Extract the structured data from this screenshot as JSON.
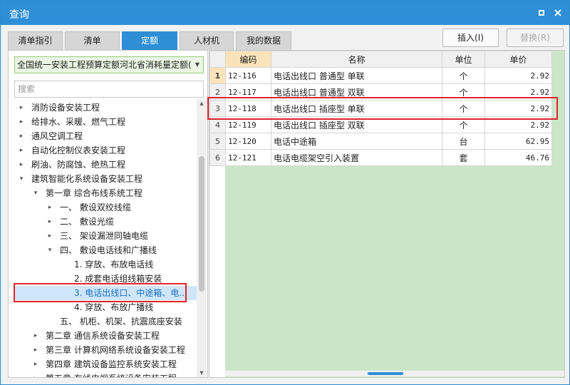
{
  "window": {
    "title": "查询",
    "maximize_icon": "maximize-icon",
    "close_icon": "close-icon",
    "close_glyph": "×"
  },
  "tabs": [
    {
      "label": "清单指引",
      "active": false
    },
    {
      "label": "清单",
      "active": false
    },
    {
      "label": "定额",
      "active": true
    },
    {
      "label": "人材机",
      "active": false
    },
    {
      "label": "我的数据",
      "active": false
    }
  ],
  "actions": {
    "insert_label": "插入(I)",
    "replace_label": "替换(R)",
    "replace_disabled": true
  },
  "left": {
    "quota_db": "全国统一安装工程预算定额河北省消耗量定额(",
    "search_placeholder": "搜索",
    "tree": [
      {
        "label": "消防设备安装工程",
        "level": 0,
        "toggle": "▸"
      },
      {
        "label": "给排水、采暖、燃气工程",
        "level": 0,
        "toggle": "▸"
      },
      {
        "label": "通风空调工程",
        "level": 0,
        "toggle": "▸"
      },
      {
        "label": "自动化控制仪表安装工程",
        "level": 0,
        "toggle": "▸"
      },
      {
        "label": "刷油、防腐蚀、绝热工程",
        "level": 0,
        "toggle": "▸"
      },
      {
        "label": "建筑智能化系统设备安装工程",
        "level": 0,
        "toggle": "▾"
      },
      {
        "label": "第一章 综合布线系统工程",
        "level": 1,
        "toggle": "▾"
      },
      {
        "label": "一、 敷设双绞线缆",
        "level": 2,
        "toggle": "▸"
      },
      {
        "label": "二、 敷设光缆",
        "level": 2,
        "toggle": "▸"
      },
      {
        "label": "三、 架设漏泄同轴电缆",
        "level": 2,
        "toggle": "▸"
      },
      {
        "label": "四、 敷设电话线和广播线",
        "level": 2,
        "toggle": "▾"
      },
      {
        "label": "1. 穿放、布放电话线",
        "level": 3,
        "toggle": ""
      },
      {
        "label": "2. 成套电话组线箱安装",
        "level": 3,
        "toggle": ""
      },
      {
        "label": "3. 电话出线口、中途箱、电...",
        "level": 3,
        "toggle": "",
        "selected": true
      },
      {
        "label": "4. 穿放、布放广播线",
        "level": 3,
        "toggle": ""
      },
      {
        "label": "五、 机柜、机架、抗震底座安装",
        "level": 2,
        "toggle": ""
      },
      {
        "label": "第二章 通信系统设备安装工程",
        "level": 1,
        "toggle": "▸"
      },
      {
        "label": "第三章 计算机网络系统设备安装工程",
        "level": 1,
        "toggle": "▸"
      },
      {
        "label": "第四章 建筑设备监控系统安装工程",
        "level": 1,
        "toggle": "▸"
      },
      {
        "label": "第五章 有线电视系统设备安装工程",
        "level": 1,
        "toggle": "▸"
      }
    ]
  },
  "grid": {
    "columns": [
      "编码",
      "名称",
      "单位",
      "单价"
    ],
    "rows": [
      {
        "n": "1",
        "code": "12-116",
        "name": "电话出线口 普通型 单联",
        "unit": "个",
        "price": "2.92"
      },
      {
        "n": "2",
        "code": "12-117",
        "name": "电话出线口 普通型 双联",
        "unit": "个",
        "price": "2.92"
      },
      {
        "n": "3",
        "code": "12-118",
        "name": "电话出线口 插座型 单联",
        "unit": "个",
        "price": "2.92"
      },
      {
        "n": "4",
        "code": "12-119",
        "name": "电话出线口 插座型 双联",
        "unit": "个",
        "price": "2.92"
      },
      {
        "n": "5",
        "code": "12-120",
        "name": "电话中途箱",
        "unit": "台",
        "price": "62.95"
      },
      {
        "n": "6",
        "code": "12-121",
        "name": "电话电缆架空引入装置",
        "unit": "套",
        "price": "46.76"
      }
    ]
  },
  "colors": {
    "title_bar": "#2e8fd6",
    "grid_background": "#cbe5c8",
    "highlight": "#e0232b",
    "selected_row": "#cfe6fa"
  }
}
